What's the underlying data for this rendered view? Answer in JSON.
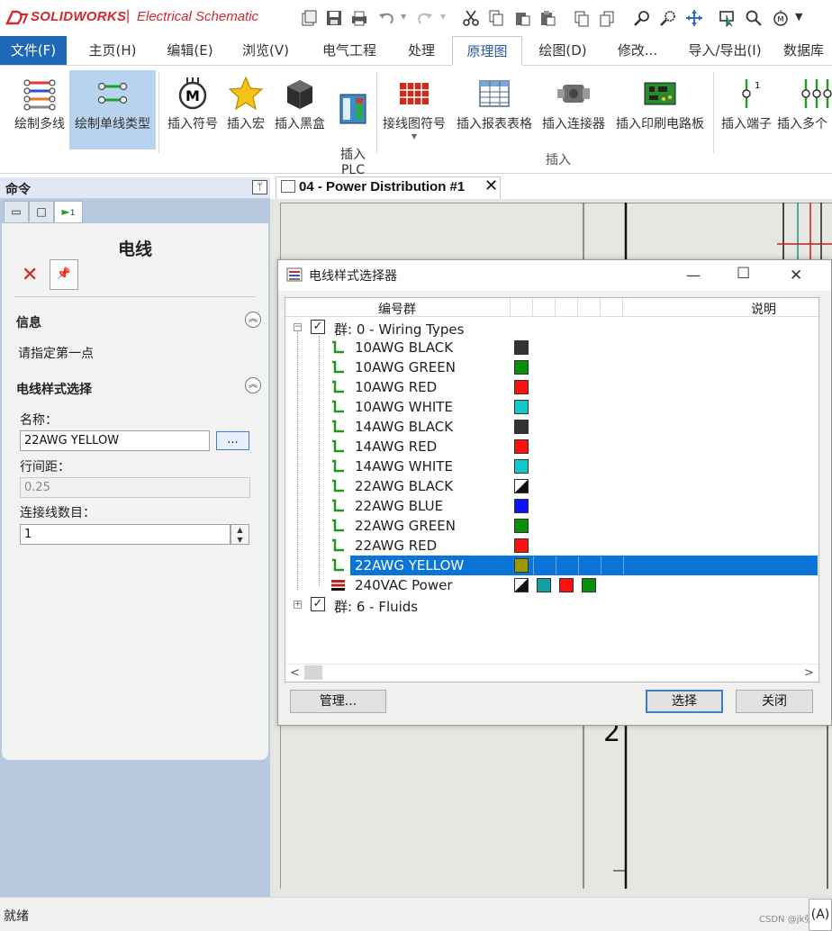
{
  "app": {
    "brand": "SOLIDWORKS",
    "separator": "|",
    "product": "Electrical Schematic"
  },
  "menu": {
    "file": "文件(F)",
    "tabs": [
      "主页(H)",
      "编辑(E)",
      "浏览(V)",
      "电气工程",
      "处理",
      "原理图",
      "绘图(D)",
      "修改...",
      "导入/导出(I)",
      "数据库"
    ],
    "active_tab": "原理图"
  },
  "ribbon": {
    "buttons": [
      "绘制多线",
      "绘制单线类型",
      "插入符号",
      "插入宏",
      "插入黑盒",
      "插入\nPLC",
      "接线图符号",
      "插入报表表格",
      "插入连接器",
      "插入印刷电路板",
      "插入端子",
      "插入多个"
    ],
    "active": "绘制单线类型",
    "group_label": "插入"
  },
  "cmd": {
    "title": "命令",
    "pin": "ᛘ",
    "panel_title": "电线",
    "info_header": "信息",
    "info_text": "请指定第一点",
    "style_header": "电线样式选择",
    "name_label": "名称：",
    "name_value": "22AWG YELLOW",
    "browse": "...",
    "spacing_label": "行间距：",
    "spacing_value": "0.25",
    "count_label": "连接线数目：",
    "count_value": "1",
    "tab_arrow": "1"
  },
  "doc": {
    "tab_label": "04 - Power Distribution #1",
    "close": "✕",
    "zone": "2"
  },
  "dialog": {
    "title": "电线样式选择器",
    "minimize": "—",
    "maximize": "☐",
    "close": "✕",
    "col1": "编号群",
    "col2": "说明",
    "group0": "群: 0 - Wiring Types",
    "group6": "群: 6 - Fluids",
    "items": [
      {
        "label": "10AWG BLACK",
        "colors": [
          "#333333"
        ]
      },
      {
        "label": "10AWG GREEN",
        "colors": [
          "#0a8f0a"
        ]
      },
      {
        "label": "10AWG RED",
        "colors": [
          "#ff1010"
        ]
      },
      {
        "label": "10AWG WHITE",
        "colors": [
          "#12c8cc"
        ]
      },
      {
        "label": "14AWG BLACK",
        "colors": [
          "#333333"
        ]
      },
      {
        "label": "14AWG RED",
        "colors": [
          "#ff1010"
        ]
      },
      {
        "label": "14AWG WHITE",
        "colors": [
          "#12c8cc"
        ]
      },
      {
        "label": "22AWG BLACK",
        "colors": [
          "diag"
        ]
      },
      {
        "label": "22AWG BLUE",
        "colors": [
          "#1010ff"
        ]
      },
      {
        "label": "22AWG GREEN",
        "colors": [
          "#0a8f0a"
        ]
      },
      {
        "label": "22AWG RED",
        "colors": [
          "#ff1010"
        ]
      },
      {
        "label": "22AWG YELLOW",
        "colors": [
          "#999900"
        ],
        "selected": true
      },
      {
        "label": "240VAC Power",
        "colors": [
          "diag",
          "#12a0a0",
          "#ff1010",
          "#0a8f0a"
        ],
        "multi": true
      }
    ],
    "manage": "管理...",
    "select": "选择",
    "close_btn": "关闭"
  },
  "status": {
    "text": "就绪",
    "right": "(A)",
    "watermark": "CSDN @jk强"
  },
  "colors": {
    "accent": "#1e68b8",
    "selection": "#0a74d8",
    "brand": "#d7262e"
  }
}
